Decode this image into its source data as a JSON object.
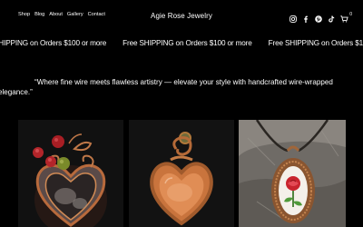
{
  "header": {
    "nav": [
      "Shop",
      "Blog",
      "About",
      "Gallery",
      "Contact"
    ],
    "site_title": "Agie Rose Jewelry",
    "icons": [
      "instagram-icon",
      "facebook-icon",
      "pinterest-icon",
      "tiktok-icon",
      "cart-icon"
    ],
    "cart_count": "0"
  },
  "banner": {
    "items": [
      "SHIPPING on Orders $100 or more",
      "Free SHIPPING on Orders $100 or more",
      "Free SHIPPING on Orders $100 or more"
    ]
  },
  "quote": {
    "line1": "“Where fine wire meets flawless artistry — elevate your style with handcrafted wire-wrapped",
    "line2": "elegance.”"
  },
  "products": [
    {
      "image": "copper-wire-heart-pendant-red-beads"
    },
    {
      "image": "copper-wire-heart-pendant-orange-stone"
    },
    {
      "image": "wire-wrapped-rose-pendant-on-rock"
    }
  ],
  "colors": {
    "background": "#000000",
    "text": "#ffffff",
    "copper": "#b86a3c"
  }
}
